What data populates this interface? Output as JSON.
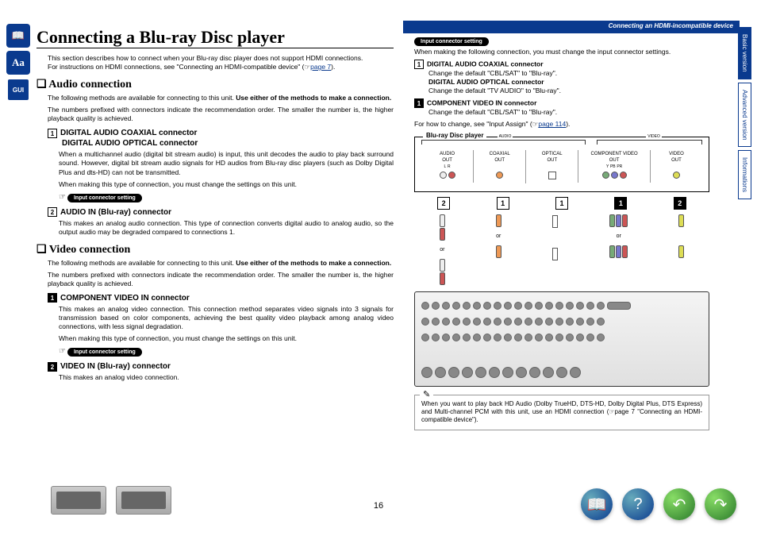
{
  "header_strip": "Connecting an HDMI-incompatible device",
  "title": "Connecting a Blu-ray Disc player",
  "intro1": "This section describes how to connect when your Blu-ray disc player does not support HDMI connections.",
  "intro2_a": "For instructions on HDMI connections, see \"Connecting an HDMI-compatible device\" (",
  "intro2_link": "page 7",
  "intro2_b": ").",
  "audio": {
    "heading": "Audio connection",
    "p1a": "The following methods are available for connecting to this unit. ",
    "p1b": "Use either of the methods to make a connection.",
    "p2": "The numbers prefixed with connectors indicate the recommendation order. The smaller the number is, the higher playback quality is achieved.",
    "c1": {
      "num": "1",
      "t1": "DIGITAL AUDIO COAXIAL connector",
      "t2": "DIGITAL AUDIO OPTICAL connector",
      "d1": "When a multichannel audio (digital bit stream audio) is input, this unit decodes the audio to play back surround sound. However, digital bit stream audio signals for HD audios from Blu-ray disc players (such as Dolby Digital Plus and dts-HD) can not be transmitted.",
      "d2": "When making this type of connection, you must change the settings on this unit.",
      "pill": "Input connector setting"
    },
    "c2": {
      "num": "2",
      "t1": "AUDIO IN (Blu-ray) connector",
      "d1": "This makes an analog audio connection. This type of connection converts digital audio to analog audio, so the output audio may be degraded compared to connections 1."
    }
  },
  "video": {
    "heading": "Video connection",
    "p1a": "The following methods are available for connecting to this unit. ",
    "p1b": "Use either of the methods to make a connection.",
    "p2": "The numbers prefixed with connectors indicate the recommendation order. The smaller the number is, the higher playback quality is achieved.",
    "c1": {
      "num": "1",
      "t1": "COMPONENT VIDEO IN connector",
      "d1": "This makes an analog video connection. This connection method separates video signals into 3 signals for transmission based on color components, achieving the best quality video playback among analog video connections, with less signal degradation.",
      "d2": "When making this type of connection, you must change the settings on this unit.",
      "pill": "Input connector setting"
    },
    "c2": {
      "num": "2",
      "t1": "VIDEO IN (Blu-ray) connector",
      "d1": "This makes an analog video connection."
    }
  },
  "right": {
    "pill": "Input connector setting",
    "intro": "When making the following connection, you must change the input connector settings.",
    "i1": {
      "num": "1",
      "t": "DIGITAL AUDIO COAXIAL connector",
      "d": "Change the default \"CBL/SAT\" to \"Blu-ray\".",
      "t2": "DIGITAL AUDIO OPTICAL connector",
      "d2": "Change the default \"TV AUDIO\" to \"Blu-ray\"."
    },
    "i2": {
      "num": "1",
      "t": "COMPONENT VIDEO IN connector",
      "d": "Change the default \"CBL/SAT\" to \"Blu-ray\"."
    },
    "howto_a": "For how to change, see \"Input Assign\" (",
    "howto_link": "page 114",
    "howto_b": ")."
  },
  "diagram": {
    "title": "Blu-ray Disc player",
    "grp_audio": "AUDIO",
    "grp_video": "VIDEO",
    "h_audio": "AUDIO\nOUT",
    "h_coax": "COAXIAL\nOUT",
    "h_opt": "OPTICAL\nOUT",
    "h_comp": "COMPONENT VIDEO\nOUT",
    "h_vid": "VIDEO\nOUT",
    "lr": {
      "l": "L",
      "r": "R"
    },
    "ypbpr": {
      "y": "Y",
      "pb": "PB",
      "pr": "PR"
    },
    "nums": [
      "2",
      "1",
      "1",
      "1",
      "2"
    ],
    "or": "or"
  },
  "note": "When you want to play back HD Audio (Dolby TrueHD, DTS-HD, Dolby Digital Plus, DTS Express) and Multi-channel PCM with this unit, use an HDMI connection (☞page 7 \"Connecting an HDMI-compatible device\").",
  "note_link": "page 7",
  "tabs": {
    "basic": "Basic version",
    "advanced": "Advanced version",
    "info": "Informations"
  },
  "page_num": "16",
  "icons": {
    "book": "book-icon",
    "aa": "aa-icon",
    "gui": "gui-icon",
    "hand": "☞"
  }
}
